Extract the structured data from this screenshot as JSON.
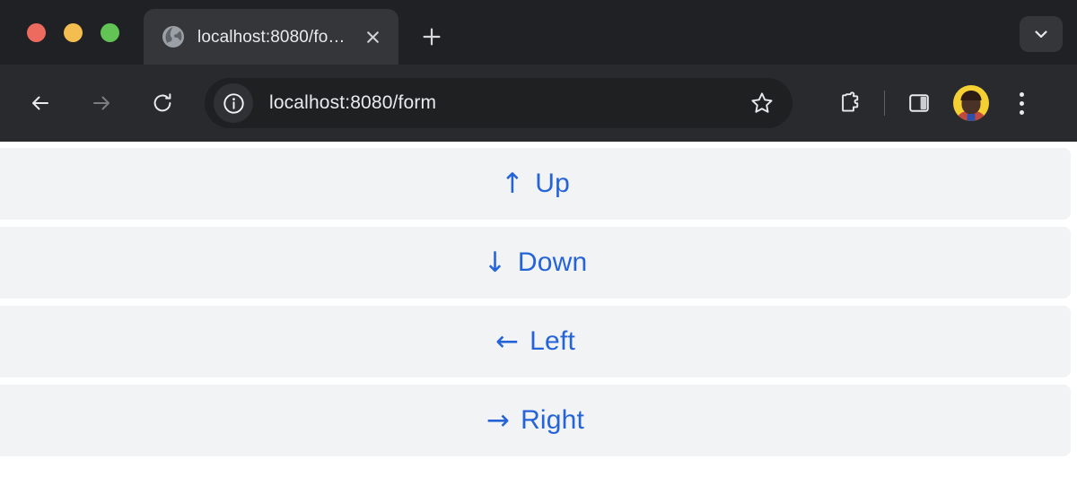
{
  "browser": {
    "window_controls": [
      {
        "name": "close",
        "color": "#ec6a5e"
      },
      {
        "name": "minimize",
        "color": "#f4bd4f"
      },
      {
        "name": "maximize",
        "color": "#61c454"
      }
    ],
    "tab": {
      "title": "localhost:8080/form",
      "favicon": "globe-icon",
      "close_label": "×"
    },
    "new_tab_label": "+",
    "tab_list_chevron": "chevron-down-icon",
    "toolbar": {
      "back": "back-arrow-icon",
      "forward": "forward-arrow-icon",
      "reload": "reload-icon",
      "site_info": "info-circle-icon",
      "url": "localhost:8080/form",
      "bookmark": "star-icon",
      "extensions": "puzzle-icon",
      "side_panel": "side-panel-icon",
      "profile": "avatar-icon",
      "menu": "three-dot-menu-icon"
    }
  },
  "page": {
    "accent_color": "#2563d9",
    "row_background": "#f2f3f5",
    "rows": [
      {
        "arrow": "↑",
        "label": "Up",
        "icon_name": "arrow-up-icon"
      },
      {
        "arrow": "↓",
        "label": "Down",
        "icon_name": "arrow-down-icon"
      },
      {
        "arrow": "←",
        "label": "Left",
        "icon_name": "arrow-left-icon"
      },
      {
        "arrow": "→",
        "label": "Right",
        "icon_name": "arrow-right-icon"
      }
    ]
  }
}
